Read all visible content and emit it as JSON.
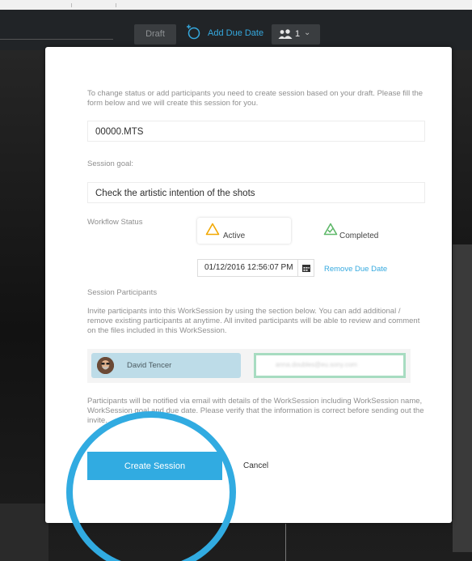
{
  "toolbar": {
    "draft_label": "Draft",
    "add_due_date_label": "Add Due Date",
    "participants_count": "1",
    "icons": [
      "clock-plus-icon",
      "people-icon",
      "chevron-down-icon"
    ]
  },
  "modal": {
    "intro": "To change status or add participants you need to create session based on your draft. Please fill the form below and we will create this session for you.",
    "session_name_value": "00000.MTS",
    "goal_label": "Session goal:",
    "goal_value": "Check the artistic intention of the shots",
    "workflow_label": "Workflow Status",
    "status_active": "Active",
    "status_completed": "Completed",
    "due_date_value": "01/12/2016 12:56:07 PM",
    "remove_due_label": "Remove Due Date",
    "participants_label": "Session Participants",
    "invite_text": "Invite participants into this WorkSession by using the section below. You can add additional / remove existing participants at anytime. All invited participants will be able to review and comment on the files included in this WorkSession.",
    "participant_name": "David Tencer",
    "email_value": "anna.doubles@eu.sony.com",
    "notify_text": "Participants will be notified via email with details of the WorkSession including WorkSession name, WorkSession goal and due date. Please verify that the information is correct before sending out the invite.",
    "create_label": "Create Session",
    "cancel_label": "Cancel"
  },
  "colors": {
    "accent": "#31abe1",
    "active_status": "#f2a800",
    "completed_status": "#5fb86a",
    "highlight_ring": "#31abe1"
  }
}
